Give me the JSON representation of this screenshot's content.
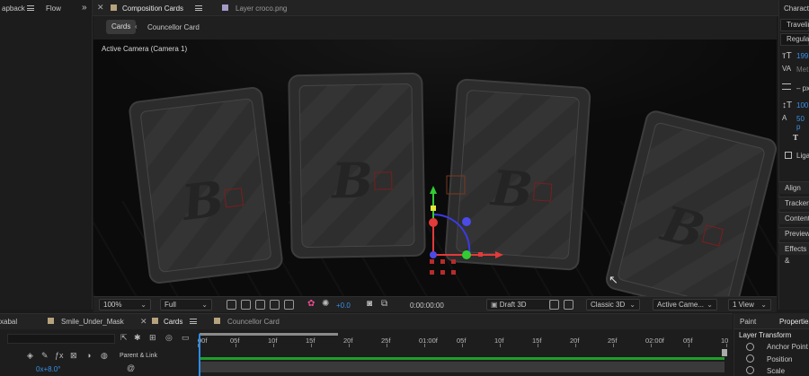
{
  "top_tabs": {
    "left_tab": "apback",
    "left_tab2": "Flow",
    "comp_tab": "Composition Cards",
    "layer_tab": "Layer croco.png",
    "right_tab": "Characte"
  },
  "breadcrumbs": [
    "Cards",
    "Councellor Card"
  ],
  "viewer": {
    "camera_label": "Active Camera (Camera 1)",
    "zoom": "100%",
    "resolution": "Full",
    "exposure": "+0.0",
    "timecode": "0:00:00:00",
    "renderer": "Draft 3D",
    "view_mode": "Classic 3D",
    "camera_select": "Active Came...",
    "views": "1 View"
  },
  "character_panel": {
    "font": "Travelin",
    "style": "Regular",
    "size": "199",
    "kerning": "Met",
    "leading_unit": "– px",
    "vscale": "100",
    "baseline": "50 p",
    "ligatures": "Liga"
  },
  "right_sections": [
    "Align",
    "Tracker",
    "Content",
    "Preview",
    "Effects &"
  ],
  "timeline": {
    "tabs": [
      "xabal",
      "Smile_Under_Mask",
      "Cards",
      "Councellor Card"
    ],
    "parent_link_label": "Parent & Link",
    "value": "0x+8.0°",
    "ticks": [
      "00f",
      "05f",
      "10f",
      "15f",
      "20f",
      "25f",
      "01:00f",
      "05f",
      "10f",
      "15f",
      "20f",
      "25f",
      "02:00f",
      "05f",
      "10"
    ]
  },
  "properties": {
    "tabs": [
      "Paint",
      "Properties"
    ],
    "section": "Layer Transform",
    "items": [
      "Anchor Point",
      "Position",
      "Scale"
    ]
  },
  "colors": {
    "accent_blue": "#2d8ceb",
    "axis_green": "#33cc33",
    "axis_red": "#e33a3a",
    "axis_blue": "#3a3ae6",
    "track_green": "#1f9e2b"
  }
}
